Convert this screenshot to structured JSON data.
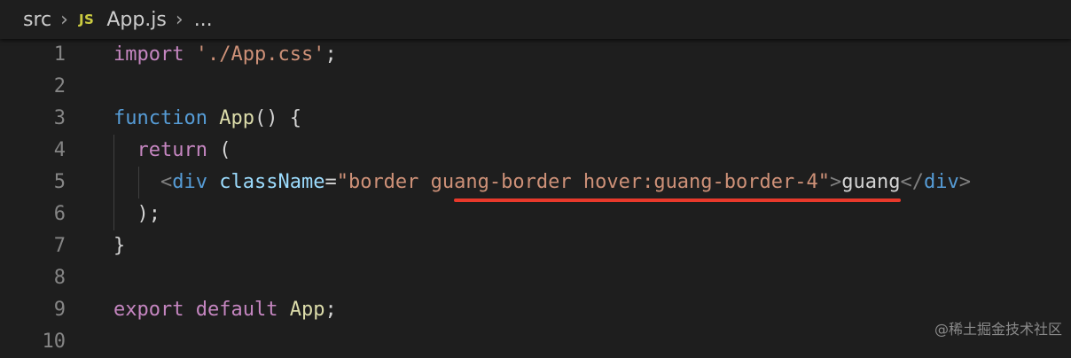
{
  "breadcrumb": {
    "folder": "src",
    "file_icon": "JS",
    "file": "App.js",
    "ellipsis": "..."
  },
  "code_lines": [
    {
      "num": "1",
      "tokens": [
        {
          "t": "import",
          "c": "ctrl"
        },
        {
          "t": " ",
          "c": "plain"
        },
        {
          "t": "'./App.css'",
          "c": "str"
        },
        {
          "t": ";",
          "c": "plain"
        }
      ]
    },
    {
      "num": "2",
      "tokens": []
    },
    {
      "num": "3",
      "tokens": [
        {
          "t": "function",
          "c": "kw"
        },
        {
          "t": " ",
          "c": "plain"
        },
        {
          "t": "App",
          "c": "fn"
        },
        {
          "t": "() {",
          "c": "plain"
        }
      ]
    },
    {
      "num": "4",
      "tokens": [
        {
          "t": "  ",
          "c": "plain"
        },
        {
          "t": "return",
          "c": "ctrl"
        },
        {
          "t": " (",
          "c": "plain"
        }
      ]
    },
    {
      "num": "5",
      "tokens": [
        {
          "t": "    ",
          "c": "plain"
        },
        {
          "t": "<",
          "c": "punc"
        },
        {
          "t": "div",
          "c": "tag"
        },
        {
          "t": " ",
          "c": "plain"
        },
        {
          "t": "className",
          "c": "attr"
        },
        {
          "t": "=",
          "c": "plain"
        },
        {
          "t": "\"border guang-border hover:guang-border-4\"",
          "c": "str"
        },
        {
          "t": ">",
          "c": "punc"
        },
        {
          "t": "guang",
          "c": "plain"
        },
        {
          "t": "</",
          "c": "punc"
        },
        {
          "t": "div",
          "c": "tag"
        },
        {
          "t": ">",
          "c": "punc"
        }
      ]
    },
    {
      "num": "6",
      "tokens": [
        {
          "t": "  );",
          "c": "plain"
        }
      ]
    },
    {
      "num": "7",
      "tokens": [
        {
          "t": "}",
          "c": "plain"
        }
      ]
    },
    {
      "num": "8",
      "tokens": []
    },
    {
      "num": "9",
      "tokens": [
        {
          "t": "export",
          "c": "ctrl"
        },
        {
          "t": " ",
          "c": "plain"
        },
        {
          "t": "default",
          "c": "ctrl"
        },
        {
          "t": " ",
          "c": "plain"
        },
        {
          "t": "App",
          "c": "fn"
        },
        {
          "t": ";",
          "c": "plain"
        }
      ]
    },
    {
      "num": "10",
      "tokens": []
    }
  ],
  "highlight": {
    "line": "5",
    "text": "guang-border hover:guang-border-4\"",
    "color": "#e8392b"
  },
  "watermark": "@稀土掘金技术社区"
}
